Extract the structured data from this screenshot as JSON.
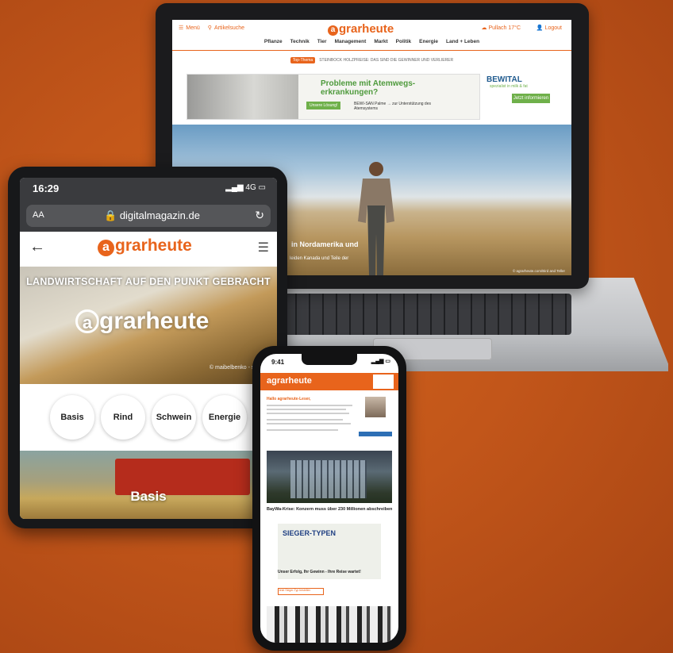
{
  "laptop": {
    "menu_label": "Menü",
    "search_label": "Artikelsuche",
    "logo": "grarheute",
    "logo_a": "a",
    "weather": "Pullach 17°C",
    "logout": "Logout",
    "nav": [
      "Pflanze",
      "Technik",
      "Tier",
      "Management",
      "Markt",
      "Politik",
      "Energie",
      "Land + Leben"
    ],
    "topic_tag": "Top-Thema",
    "topic_text": "STEINBOCK HOLZPREISE: DAS SIND DIE GEWINNER UND VERLIERER",
    "ad_headline": "Probleme mit Atemwegs-erkrankungen?",
    "ad_button": "Unsere Lösung!",
    "ad_sub": "BEWI-SAN Palme → zur Unterstützung des Atemsystems",
    "ad2_brand": "BEWITAL",
    "ad2_tagline": "spezialist in milk & fat",
    "ad2_button": "Jetzt informieren",
    "hero_caption": "in Nordamerika und",
    "hero_caption2": "leiden Kanada und Teile der",
    "hero_credit": "© agrarheute.com/Bird and Teller"
  },
  "tablet": {
    "time": "16:29",
    "signal": "4G",
    "text_size": "AA",
    "domain": "digitalmagazin.de",
    "logo": "grarheute",
    "logo_a": "a",
    "slogan": "LANDWIRTSCHAFT AUF DEN PUNKT GEBRACHT",
    "brand": "grarheute",
    "brand_a": "a",
    "credit": "© maibelbenko - stock.ad",
    "categories": [
      "Basis",
      "Rind",
      "Schwein",
      "Energie"
    ],
    "section_title": "Basis"
  },
  "phone": {
    "time": "9:41",
    "logo": "agrarheute",
    "greeting": "Hallo agrarheute-Leser,",
    "article1_title": "BayWa-Krise: Konzern muss über 230 Millionen abschreiben",
    "ad_title": "SIEGER-TYPEN",
    "article2_title": "Unser Erfolg, Ihr Gewinn - Ihre Reise wartet!",
    "button_label": "Jetzt Sieger-Typ bestellen"
  }
}
